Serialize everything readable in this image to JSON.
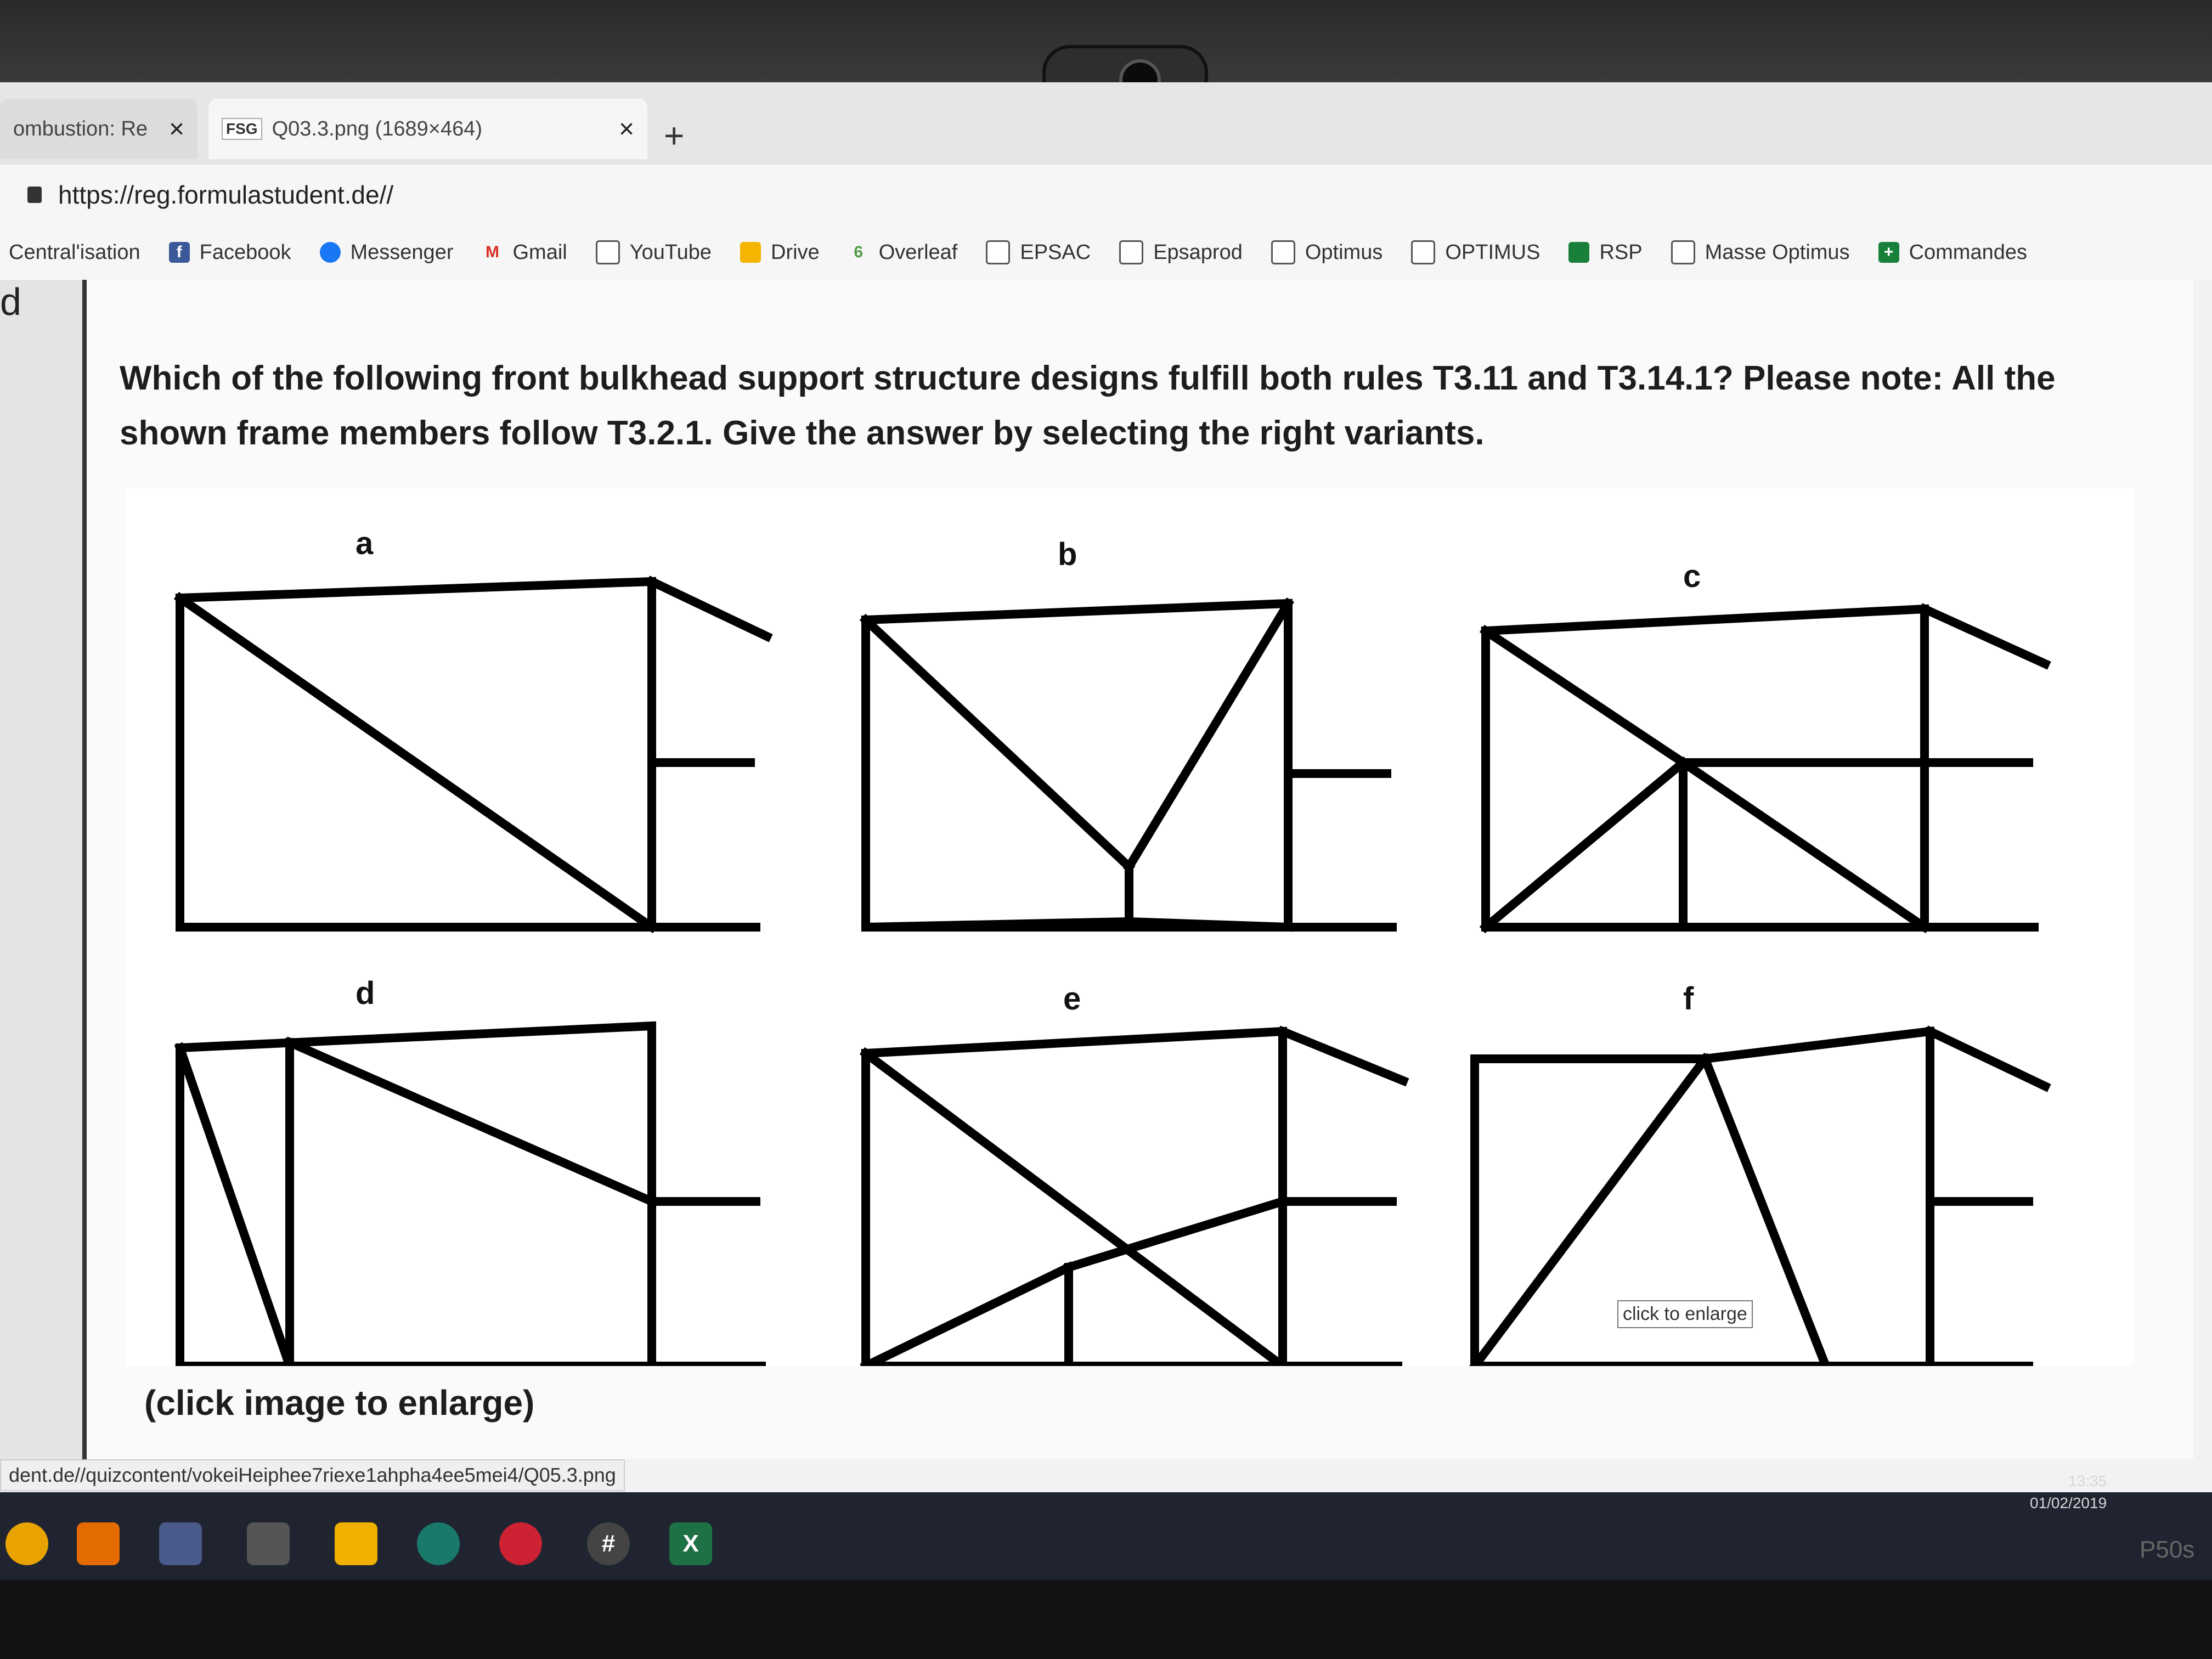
{
  "browser": {
    "tabs": [
      {
        "title": "ombustion: Re",
        "active": false
      },
      {
        "favicon": "FSG",
        "title": "Q03.3.png (1689×464)",
        "active": true
      }
    ],
    "new_tab_label": "+",
    "close_label": "×",
    "url": "https://reg.formulastudent.de//",
    "bookmarks": [
      {
        "label": "Central'isation",
        "icon": "none"
      },
      {
        "label": "Facebook",
        "icon": "facebook-icon"
      },
      {
        "label": "Messenger",
        "icon": "messenger-icon"
      },
      {
        "label": "Gmail",
        "icon": "gmail-icon"
      },
      {
        "label": "YouTube",
        "icon": "page-icon"
      },
      {
        "label": "Drive",
        "icon": "drive-icon"
      },
      {
        "label": "Overleaf",
        "icon": "overleaf-icon"
      },
      {
        "label": "EPSAC",
        "icon": "page-icon"
      },
      {
        "label": "Epsaprod",
        "icon": "page-icon"
      },
      {
        "label": "Optimus",
        "icon": "page-icon"
      },
      {
        "label": "OPTIMUS",
        "icon": "page-icon"
      },
      {
        "label": "RSP",
        "icon": "sheet-icon"
      },
      {
        "label": "Masse Optimus",
        "icon": "page-icon"
      },
      {
        "label": "Commandes",
        "icon": "plus-icon"
      }
    ],
    "status_url": "dent.de//quizcontent/vokeiHeiphee7riexe1ahpha4ee5mei4/Q05.3.png"
  },
  "page": {
    "gutter_letter": "d",
    "question": "Which of the following front bulkhead support structure designs fulfill both rules T3.11 and T3.14.1? Please note: All the shown frame members follow T3.2.1. Give the answer by selecting the right variants.",
    "figure_labels": [
      "a",
      "b",
      "c",
      "d",
      "e",
      "f"
    ],
    "tooltip": "click to enlarge",
    "enlarge_link": "(click image to enlarge)"
  },
  "taskbar": {
    "clock_time": "13:35",
    "clock_date": "01/02/2019",
    "brand": "P50s"
  },
  "colors": {
    "frame_stroke": "#000000",
    "page_bg": "#fafafa",
    "taskbar_bg": "#1f2430"
  }
}
